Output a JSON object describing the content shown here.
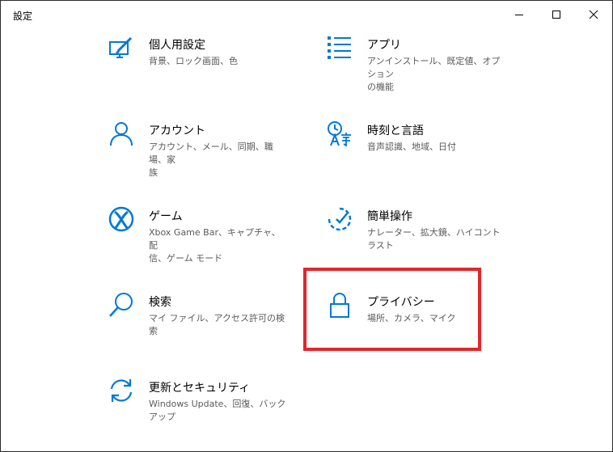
{
  "window": {
    "title": "設定"
  },
  "colors": {
    "accent": "#0078d7",
    "highlight": "#e3262b",
    "description_text": "#5a5a5a"
  },
  "tiles": [
    {
      "icon": "personalization-icon",
      "name": "個人用設定",
      "desc_lines": [
        "背景、ロック画面、色"
      ]
    },
    {
      "icon": "apps-icon",
      "name": "アプリ",
      "desc_lines": [
        "アンインストール、既定値、オプション",
        "の機能"
      ]
    },
    {
      "icon": "accounts-icon",
      "name": "アカウント",
      "desc_lines": [
        "アカウント、メール、同期、職場、家",
        "族"
      ]
    },
    {
      "icon": "time-language-icon",
      "name": "時刻と言語",
      "desc_lines": [
        "音声認識、地域、日付"
      ]
    },
    {
      "icon": "xbox-icon",
      "name": "ゲーム",
      "desc_lines": [
        "Xbox Game Bar、キャプチャ、配",
        "信、ゲーム モード"
      ]
    },
    {
      "icon": "ease-of-access-icon",
      "name": "簡単操作",
      "desc_lines": [
        "ナレーター、拡大鏡、ハイコントラスト"
      ]
    },
    {
      "icon": "search-icon",
      "name": "検索",
      "desc_lines": [
        "マイ ファイル、アクセス許可の検索"
      ]
    },
    {
      "icon": "lock-icon",
      "name": "プライバシー",
      "desc_lines": [
        "場所、カメラ、マイク"
      ]
    },
    {
      "icon": "update-icon",
      "name": "更新とセキュリティ",
      "desc_lines": [
        "Windows Update、回復、バック",
        "アップ"
      ]
    }
  ]
}
